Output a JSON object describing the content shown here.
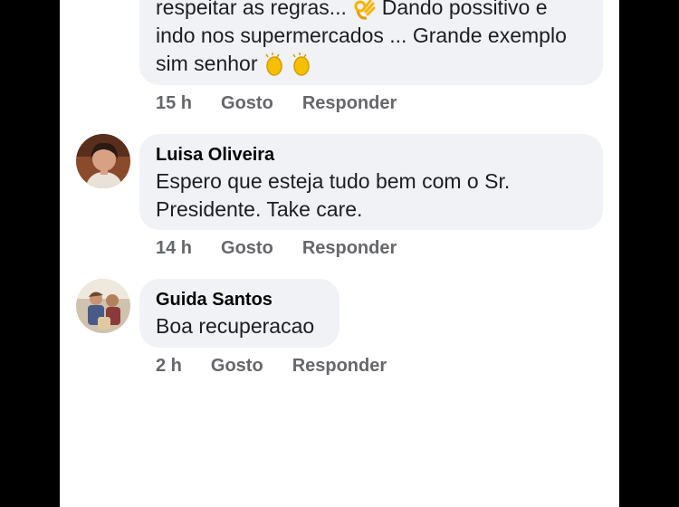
{
  "comments": [
    {
      "text_lines": [
        "respeitar as regras... ",
        " Dando possitivo e",
        "indo nos supermercados  ... Grande exemplo",
        "sim senhor "
      ],
      "emoji_ok": "ok-hand-emoji",
      "emoji_clap": "clapping-hands-emoji",
      "time": "15 h",
      "like": "Gosto",
      "reply": "Responder"
    },
    {
      "author": "Luisa Oliveira",
      "text_lines": [
        "Espero que esteja tudo bem com o Sr.",
        "Presidente. Take care."
      ],
      "time": "14 h",
      "like": "Gosto",
      "reply": "Responder"
    },
    {
      "author": "Guida Santos",
      "text_lines": [
        "Boa recuperacao"
      ],
      "time": "2 h",
      "like": "Gosto",
      "reply": "Responder"
    }
  ],
  "colors": {
    "bubble": "#f0f2f5",
    "meta": "#65676b",
    "name": "#050505",
    "frame": "#000000"
  }
}
